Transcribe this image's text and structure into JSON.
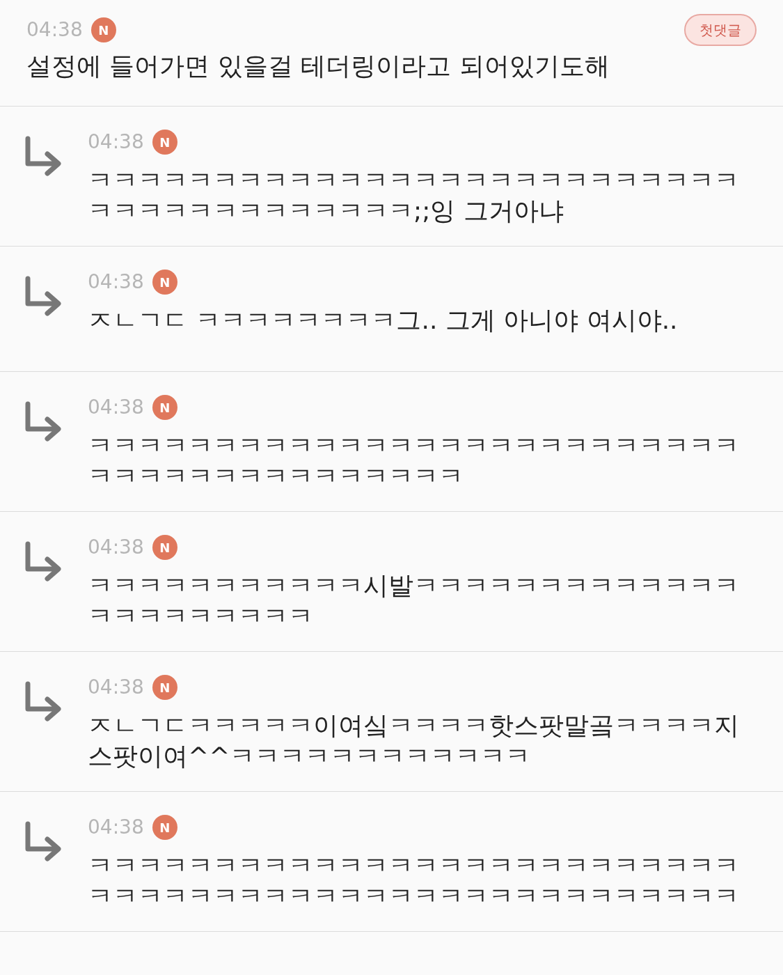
{
  "post": {
    "time": "04:38",
    "badge": "N",
    "tag": "첫댓글",
    "text": "설정에 들어가면 있을걸 테더링이라고 되어있기도해"
  },
  "replies": [
    {
      "time": "04:38",
      "badge": "N",
      "text": "ㅋㅋㅋㅋㅋㅋㅋㅋㅋㅋㅋㅋㅋㅋㅋㅋㅋㅋㅋㅋㅋㅋㅋㅋㅋㅋㅋㅋㅋㅋㅋㅋㅋㅋㅋㅋㅋㅋㅋ;;잉 그거아냐"
    },
    {
      "time": "04:38",
      "badge": "N",
      "text": "ㅈㄴㄱㄷ ㅋㅋㅋㅋㅋㅋㅋㅋ그.. 그게 아니야 여시야.."
    },
    {
      "time": "04:38",
      "badge": "N",
      "text": "ㅋㅋㅋㅋㅋㅋㅋㅋㅋㅋㅋㅋㅋㅋㅋㅋㅋㅋㅋㅋㅋㅋㅋㅋㅋㅋㅋㅋㅋㅋㅋㅋㅋㅋㅋㅋㅋㅋㅋㅋㅋ"
    },
    {
      "time": "04:38",
      "badge": "N",
      "text": "ㅋㅋㅋㅋㅋㅋㅋㅋㅋㅋㅋ시발ㅋㅋㅋㅋㅋㅋㅋㅋㅋㅋㅋㅋㅋㅋㅋㅋㅋㅋㅋㅋㅋㅋ"
    },
    {
      "time": "04:38",
      "badge": "N",
      "text": "ㅈㄴㄱㄷㅋㅋㅋㅋㅋ이여싴ㅋㅋㅋㅋ핫스팟말곸ㅋㅋㅋㅋ지스팟이여^^ㅋㅋㅋㅋㅋㅋㅋㅋㅋㅋㅋㅋ"
    },
    {
      "time": "04:38",
      "badge": "N",
      "text": "ㅋㅋㅋㅋㅋㅋㅋㅋㅋㅋㅋㅋㅋㅋㅋㅋㅋㅋㅋㅋㅋㅋㅋㅋㅋㅋㅋㅋㅋㅋㅋㅋㅋㅋㅋㅋㅋㅋㅋㅋㅋㅋㅋㅋㅋㅋㅋㅋㅋㅋㅋㅋ"
    }
  ]
}
